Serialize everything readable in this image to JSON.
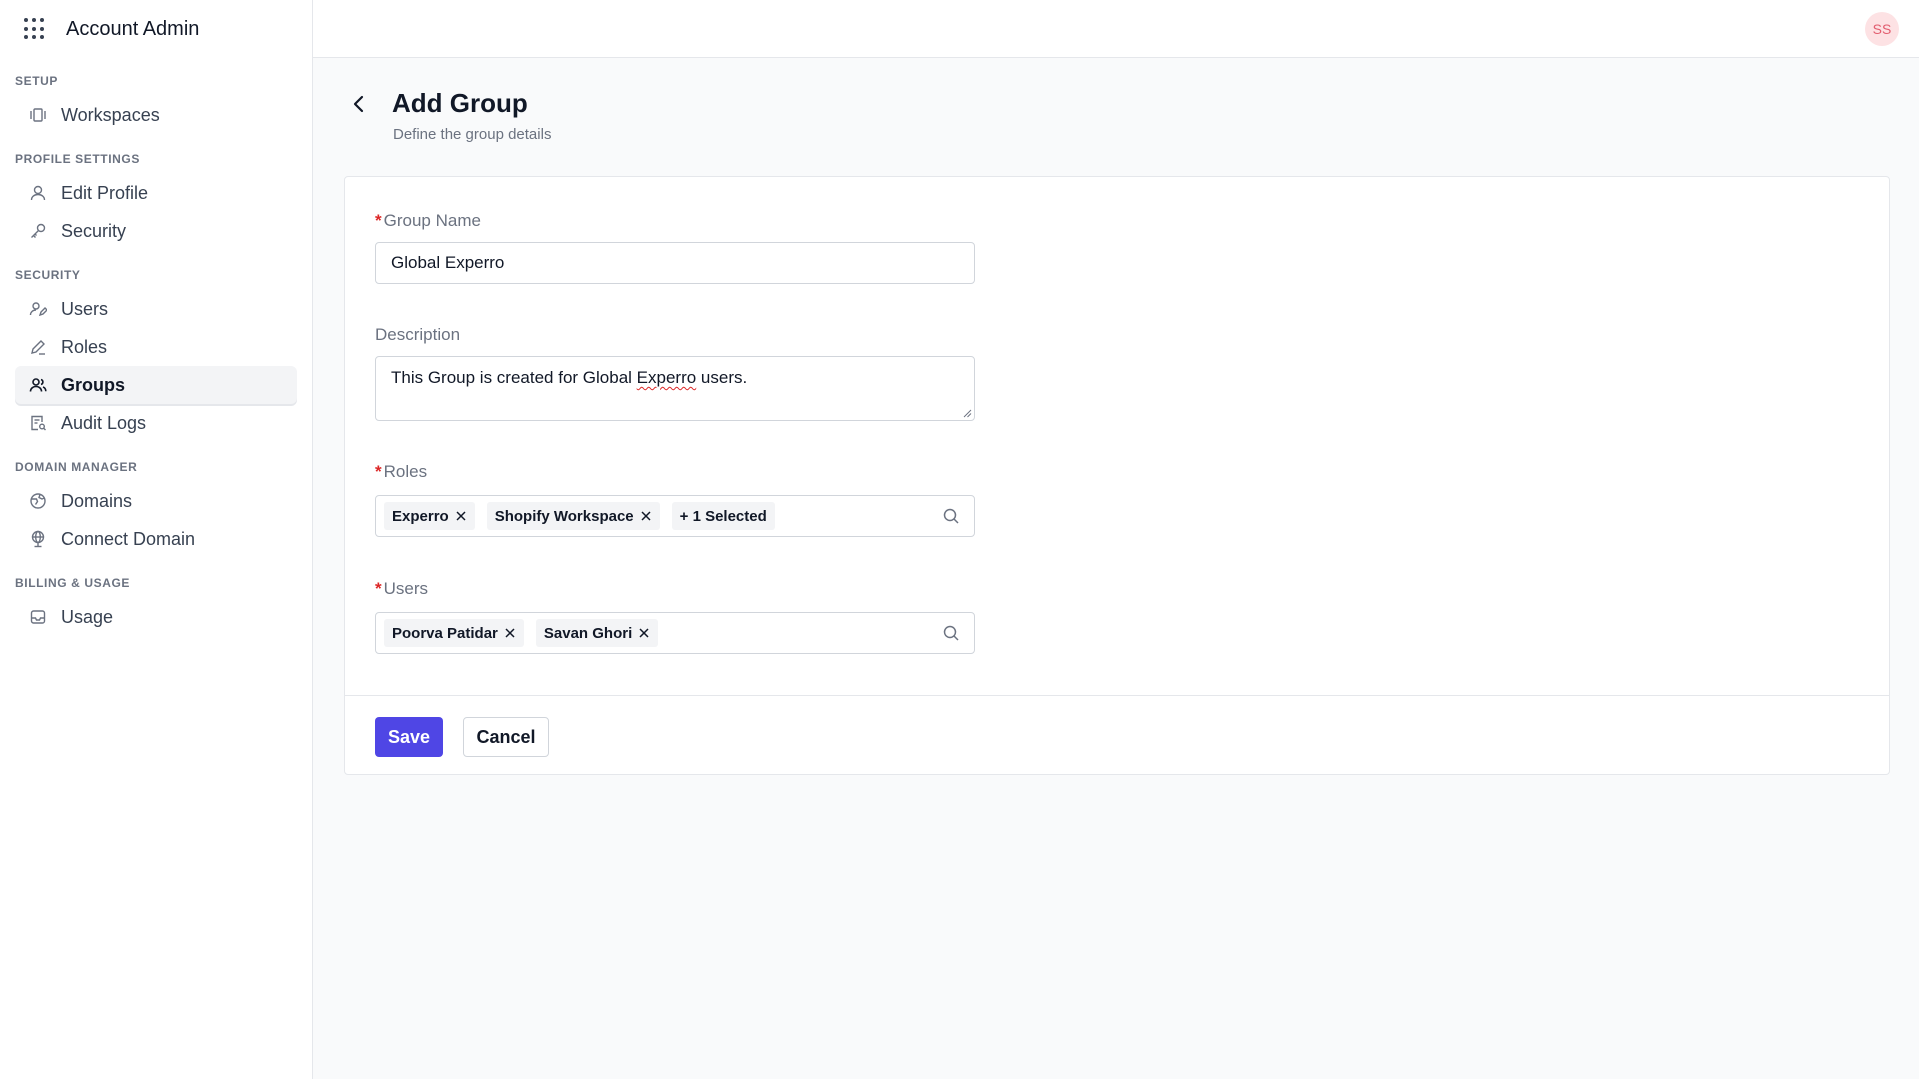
{
  "app": {
    "title": "Account Admin"
  },
  "user": {
    "initials": "SS"
  },
  "sidebar": {
    "sections": [
      {
        "title": "SETUP",
        "items": [
          {
            "label": "Workspaces",
            "icon": "workspaces-icon"
          }
        ]
      },
      {
        "title": "PROFILE SETTINGS",
        "items": [
          {
            "label": "Edit Profile",
            "icon": "user-icon"
          },
          {
            "label": "Security",
            "icon": "key-icon"
          }
        ]
      },
      {
        "title": "SECURITY",
        "items": [
          {
            "label": "Users",
            "icon": "user-edit-icon"
          },
          {
            "label": "Roles",
            "icon": "pencil-icon"
          },
          {
            "label": "Groups",
            "icon": "users-icon",
            "active": true
          },
          {
            "label": "Audit Logs",
            "icon": "document-search-icon"
          }
        ]
      },
      {
        "title": "DOMAIN MANAGER",
        "items": [
          {
            "label": "Domains",
            "icon": "globe-icon"
          },
          {
            "label": "Connect Domain",
            "icon": "globe-connect-icon"
          }
        ]
      },
      {
        "title": "BILLING & USAGE",
        "items": [
          {
            "label": "Usage",
            "icon": "inbox-icon"
          }
        ]
      }
    ]
  },
  "page": {
    "title": "Add Group",
    "subtitle": "Define the group details"
  },
  "form": {
    "group_name": {
      "label": "Group Name",
      "value": "Global Experro",
      "required": true
    },
    "description": {
      "label": "Description",
      "value_before": "This Group is created for Global ",
      "value_misspelled": "Experro",
      "value_after": " users.",
      "required": false
    },
    "roles": {
      "label": "Roles",
      "required": true,
      "chips": [
        "Experro",
        "Shopify Workspace"
      ],
      "more": "+ 1 Selected"
    },
    "users": {
      "label": "Users",
      "required": true,
      "chips": [
        "Poorva Patidar",
        "Savan Ghori"
      ]
    },
    "required_marker": "*"
  },
  "actions": {
    "save": "Save",
    "cancel": "Cancel"
  },
  "colors": {
    "primary": "#4f46e5",
    "required": "#dc2626",
    "avatar_bg": "#fde2e4",
    "avatar_text": "#e25d6f"
  }
}
